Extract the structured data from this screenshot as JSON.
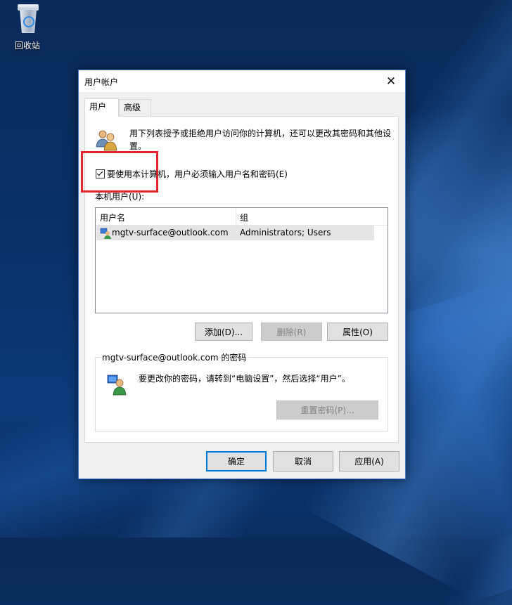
{
  "desktop": {
    "recycle_bin_label": "回收站"
  },
  "dialog": {
    "title": "用户帐户",
    "tabs": [
      "用户",
      "高级"
    ],
    "intro_text": "用下列表授予或拒绝用户访问你的计算机，还可以更改其密码和其他设置。",
    "require_login_checkbox": {
      "label": "要使用本计算机，用户必须输入用户名和密码(E)",
      "checked": true
    },
    "users_list": {
      "label": "本机用户(U):",
      "columns": [
        "用户名",
        "组"
      ],
      "rows": [
        {
          "user": "mgtv-surface@outlook.com",
          "group": "Administrators; Users"
        }
      ]
    },
    "list_buttons": {
      "add": "添加(D)...",
      "remove": "删除(R)",
      "properties": "属性(O)"
    },
    "password_group": {
      "legend": "mgtv-surface@outlook.com 的密码",
      "text": "要更改你的密码，请转到“电脑设置”，然后选择“用户”。",
      "reset_button": "重置密码(P)..."
    },
    "footer_buttons": {
      "ok": "确定",
      "cancel": "取消",
      "apply": "应用(A)"
    }
  },
  "colors": {
    "highlight_box": "#e0262c",
    "focus_border": "#0078d7"
  }
}
